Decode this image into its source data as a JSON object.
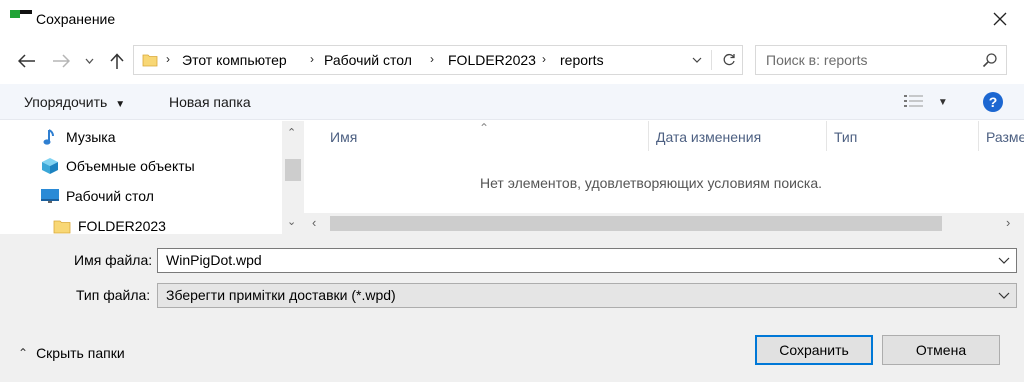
{
  "window": {
    "title": "Сохранение",
    "close_icon": "close-icon"
  },
  "nav": {
    "back_icon": "back-arrow-icon",
    "forward_icon": "forward-arrow-icon",
    "recent_icon": "chevron-down-icon",
    "up_icon": "up-arrow-icon"
  },
  "address": {
    "crumbs": [
      "Этот компьютер",
      "Рабочий стол",
      "FOLDER2023",
      "reports"
    ],
    "refresh_icon": "refresh-icon"
  },
  "search": {
    "placeholder": "Поиск в: reports"
  },
  "toolbar": {
    "organize_label": "Упорядочить",
    "new_folder_label": "Новая папка",
    "help_label": "?"
  },
  "sidebar": {
    "items": [
      {
        "label": "Музыка",
        "icon": "music-icon"
      },
      {
        "label": "Объемные объекты",
        "icon": "3d-objects-icon"
      },
      {
        "label": "Рабочий стол",
        "icon": "desktop-icon"
      },
      {
        "label": "FOLDER2023",
        "icon": "folder-icon"
      }
    ]
  },
  "file_list": {
    "columns": [
      "Имя",
      "Дата изменения",
      "Тип",
      "Размер"
    ],
    "empty_message": "Нет элементов, удовлетворяющих условиям поиска."
  },
  "form": {
    "filename_label": "Имя файла:",
    "filename_value": "WinPigDot.wpd",
    "filetype_label": "Тип файла:",
    "filetype_value": "Зберегти примітки доставки (*.wpd)"
  },
  "footer": {
    "hide_folders_label": "Скрыть папки",
    "save_label": "Сохранить",
    "cancel_label": "Отмена"
  },
  "colors": {
    "accent": "#0078d7",
    "help_blue": "#1c67d1",
    "toolbar_bg": "#f3f6fb",
    "panel_bg": "#f0f0f0"
  }
}
